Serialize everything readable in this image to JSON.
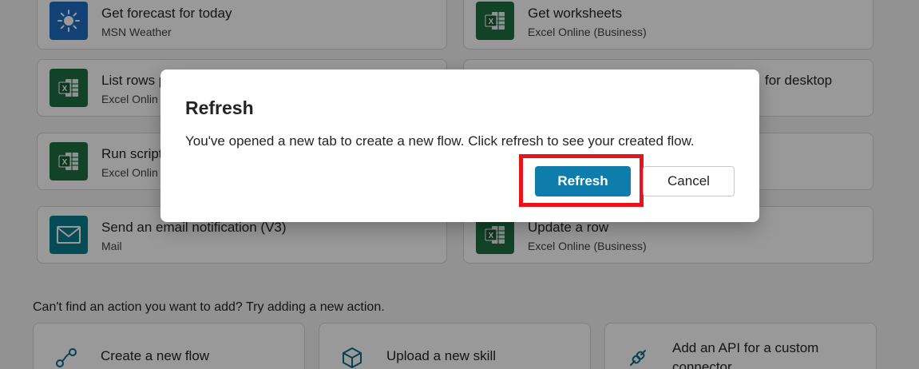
{
  "actions": [
    {
      "title": "Get forecast for today",
      "subtitle": "MSN Weather",
      "icon": "sun-icon",
      "color": "#1f6fc4"
    },
    {
      "title": "Get worksheets",
      "subtitle": "Excel Online (Business)",
      "icon": "excel-icon",
      "color": "#1e7145"
    },
    {
      "title": "List rows p",
      "subtitle": "Excel Onlin",
      "icon": "excel-icon",
      "color": "#1e7145"
    },
    {
      "title": "for desktop",
      "subtitle": "",
      "icon": "",
      "color": ""
    },
    {
      "title": "Run script",
      "subtitle": "Excel Onlin",
      "icon": "excel-icon",
      "color": "#1e7145"
    },
    {
      "title": "Send an email notification (V3)",
      "subtitle": "Mail",
      "icon": "mail-icon",
      "color": "#0a7f8f"
    },
    {
      "title": "Update a row",
      "subtitle": "Excel Online (Business)",
      "icon": "excel-icon",
      "color": "#1e7145"
    }
  ],
  "hint": "Can't find an action you want to add? Try adding a new action.",
  "bottom_cards": [
    {
      "label": "Create a new flow",
      "icon": "flow-icon"
    },
    {
      "label": "Upload a new skill",
      "icon": "cube-icon"
    },
    {
      "label": "Add an API for a custom connector",
      "icon": "link-icon"
    }
  ],
  "dialog": {
    "title": "Refresh",
    "message": "You've opened a new tab to create a new flow. Click refresh to see your created flow.",
    "refresh_label": "Refresh",
    "cancel_label": "Cancel"
  },
  "colors": {
    "primary": "#0f7dab",
    "highlight": "#e8141d",
    "excel": "#1e7145",
    "weather": "#1f6fc4",
    "mail": "#0a7f8f"
  }
}
